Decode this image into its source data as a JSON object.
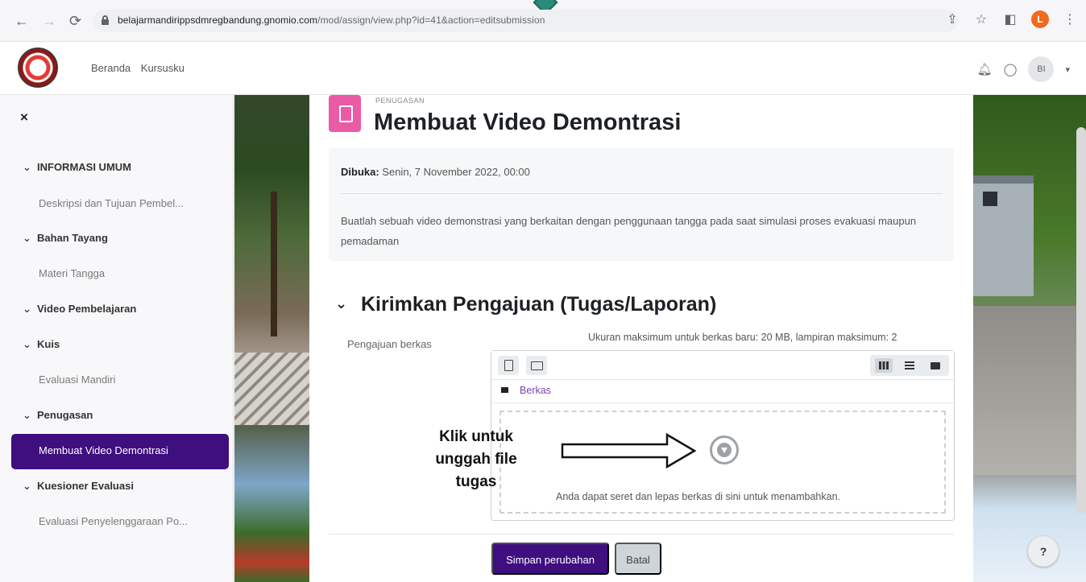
{
  "browser": {
    "url_host": "belajarmandirippsdmregbandung.gnomio.com",
    "url_path": "/mod/assign/view.php?id=41&action=editsubmission",
    "profile_initial": "L"
  },
  "navbar": {
    "links": [
      "Beranda",
      "Kursusku"
    ],
    "avatar_initials": "BI"
  },
  "drawer": {
    "close_glyph": "×",
    "sections": [
      {
        "label": "INFORMASI UMUM",
        "items": [
          "Deskripsi dan Tujuan Pembel..."
        ]
      },
      {
        "label": "Bahan Tayang",
        "items": [
          "Materi Tangga"
        ]
      },
      {
        "label": "Video Pembelajaran",
        "items": []
      },
      {
        "label": "Kuis",
        "items": [
          "Evaluasi Mandiri"
        ]
      },
      {
        "label": "Penugasan",
        "items": [
          "Membuat Video Demontrasi"
        ]
      },
      {
        "label": "Kuesioner Evaluasi",
        "items": [
          "Evaluasi Penyelenggaraan Po..."
        ]
      }
    ]
  },
  "activity": {
    "type_label": "PENUGASAN",
    "title": "Membuat Video Demontrasi",
    "opened_label": "Dibuka:",
    "opened_value": "Senin, 7 November 2022, 00:00",
    "description": "Buatlah sebuah video demonstrasi yang berkaitan dengan penggunaan tangga pada saat simulasi proses evakuasi maupun pemadaman"
  },
  "submission": {
    "section_title": "Kirimkan Pengajuan (Tugas/Laporan)",
    "field_label": "Pengajuan berkas",
    "limits_text": "Ukuran maksimum untuk berkas baru: 20 MB, lampiran maksimum: 2",
    "breadcrumb": "Berkas",
    "drop_text": "Anda dapat seret dan lepas berkas di sini untuk menambahkan.",
    "save_label": "Simpan perubahan",
    "cancel_label": "Batal"
  },
  "callout": {
    "line1": "Klik untuk",
    "line2": "unggah file",
    "line3": "tugas"
  },
  "help_label": "?",
  "colors": {
    "brand_purple": "#3f0e7f",
    "assignment_pink": "#ea5ba6"
  }
}
